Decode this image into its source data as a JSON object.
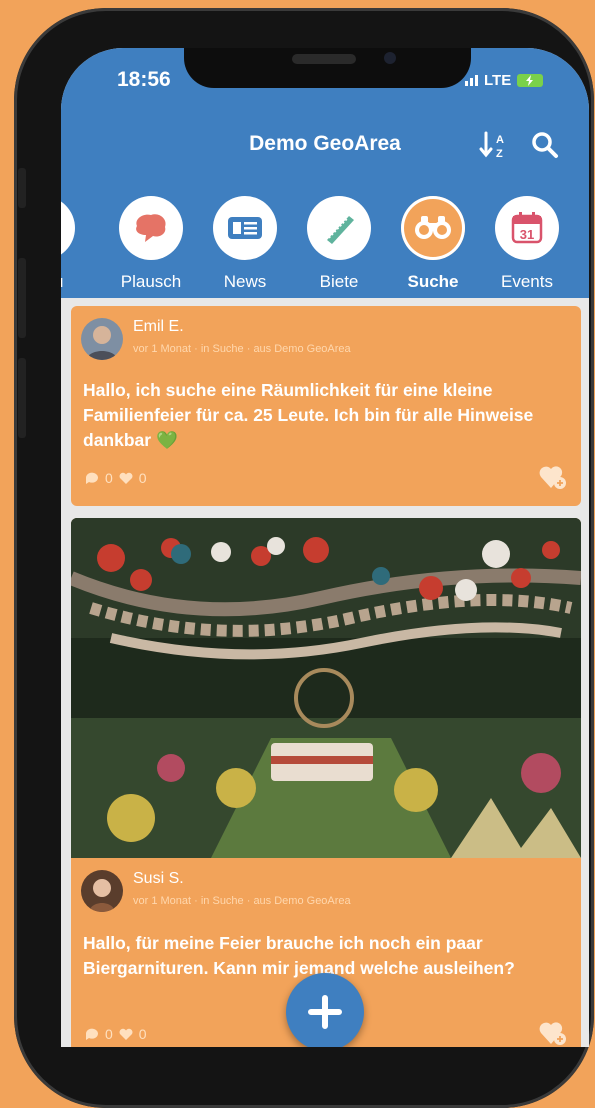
{
  "status_bar": {
    "time": "18:56",
    "network": "LTE"
  },
  "header": {
    "title": "Demo GeoArea",
    "sort_icon": "sort-az-icon",
    "search_icon": "search-icon"
  },
  "categories": [
    {
      "label": "u",
      "icon": "drop-icon",
      "active": false
    },
    {
      "label": "Plausch",
      "icon": "chat-bubble-icon",
      "active": false
    },
    {
      "label": "News",
      "icon": "newspaper-icon",
      "active": false
    },
    {
      "label": "Biete",
      "icon": "offer-tag-icon",
      "active": false
    },
    {
      "label": "Suche",
      "icon": "binoculars-icon",
      "active": true
    },
    {
      "label": "Events",
      "icon": "calendar-icon",
      "calendar_day": "31",
      "active": false
    }
  ],
  "posts": [
    {
      "author": "Emil E.",
      "meta": "vor 1 Monat · in Suche · aus Demo GeoArea",
      "text": "Hallo, ich suche eine Räumlichkeit für eine kleine Familienfeier für ca. 25 Leute. Ich bin für alle Hinweise dankbar 💚",
      "comments": "0",
      "likes": "0"
    },
    {
      "author": "Susi S.",
      "meta": "vor 1 Monat · in Suche · aus Demo GeoArea",
      "text": "Hallo, für meine Feier brauche ich noch ein paar Biergarnituren. Kann mir jemand welche ausleihen?",
      "comments": "0",
      "likes": "0"
    }
  ],
  "colors": {
    "header": "#3f7fc0",
    "card": "#f2a35a",
    "background": "#f2a35a"
  }
}
